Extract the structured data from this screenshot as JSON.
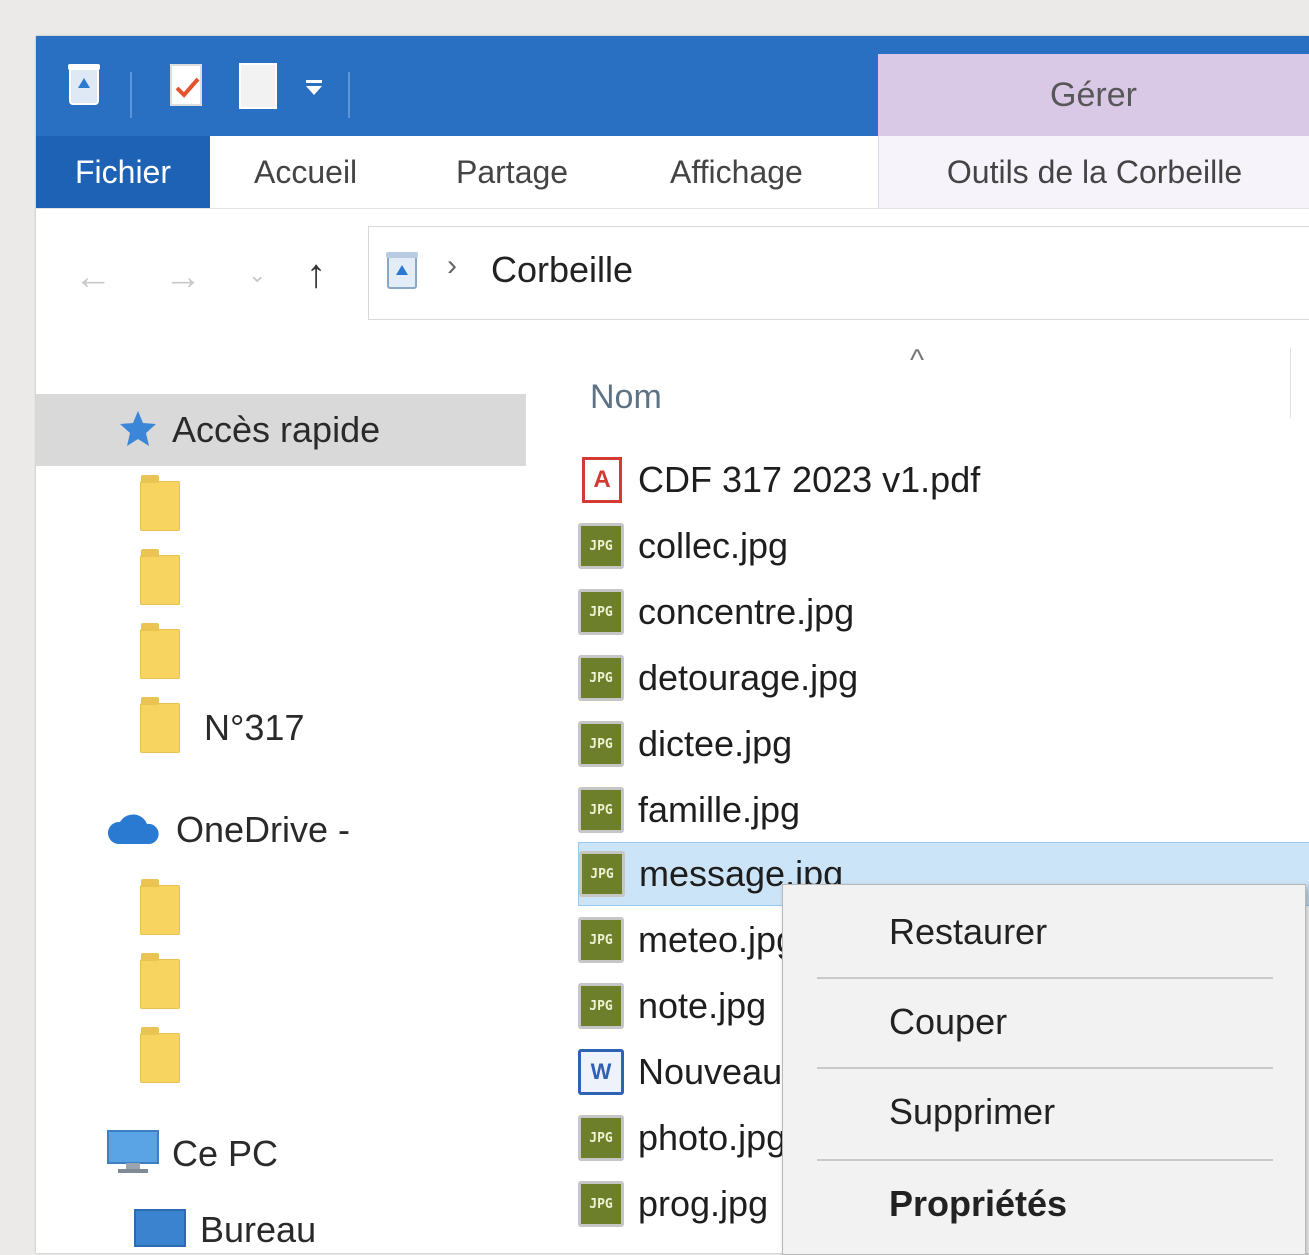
{
  "window": {
    "manage_tab": "Gérer",
    "contextual_tab": "Outils de la Corbeille"
  },
  "quick_access_toolbar": {
    "icons": [
      "recycle-bin-icon",
      "properties-icon",
      "new-folder-icon",
      "customize-dropdown-icon"
    ]
  },
  "ribbon": {
    "tabs": [
      {
        "label": "Fichier",
        "active": true
      },
      {
        "label": "Accueil"
      },
      {
        "label": "Partage"
      },
      {
        "label": "Affichage"
      }
    ]
  },
  "address_bar": {
    "path": [
      "Corbeille"
    ]
  },
  "sidebar": {
    "quick_access_label": "Accès rapide",
    "pinned_folder_label": "N°317",
    "onedrive_label": "OneDrive -",
    "this_pc_label": "Ce PC",
    "desktop_label": "Bureau"
  },
  "file_list": {
    "column_name": "Nom",
    "files": [
      {
        "name": "CDF 317 2023 v1.pdf",
        "icon": "pdf-icon"
      },
      {
        "name": "collec.jpg",
        "icon": "jpg-icon"
      },
      {
        "name": "concentre.jpg",
        "icon": "jpg-icon"
      },
      {
        "name": "detourage.jpg",
        "icon": "jpg-icon"
      },
      {
        "name": "dictee.jpg",
        "icon": "jpg-icon"
      },
      {
        "name": "famille.jpg",
        "icon": "jpg-icon"
      },
      {
        "name": "message.jpg",
        "icon": "jpg-icon",
        "selected": true
      },
      {
        "name": "meteo.jpg",
        "icon": "jpg-icon"
      },
      {
        "name": "note.jpg",
        "icon": "jpg-icon"
      },
      {
        "name": "Nouveau",
        "icon": "word-doc-icon"
      },
      {
        "name": "photo.jpg",
        "icon": "jpg-icon"
      },
      {
        "name": "prog.jpg",
        "icon": "jpg-icon"
      }
    ]
  },
  "context_menu": {
    "items": [
      "Restaurer",
      "Couper",
      "Supprimer",
      "Propriétés"
    ]
  },
  "colors": {
    "title_bar": "#2a70c2",
    "active_tab": "#1d62b4",
    "manage_tab": "#dac9e6",
    "selection": "#cce4f7"
  }
}
